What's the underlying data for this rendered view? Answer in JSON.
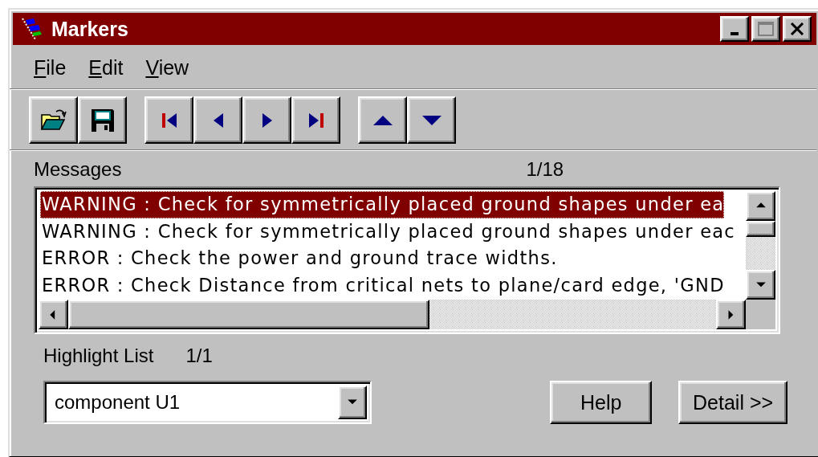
{
  "window": {
    "title": "Markers"
  },
  "menu": [
    {
      "label": "File"
    },
    {
      "label": "Edit"
    },
    {
      "label": "View"
    }
  ],
  "toolbar_groups": [
    [
      {
        "kind": "open"
      },
      {
        "kind": "save"
      }
    ],
    [
      {
        "kind": "first"
      },
      {
        "kind": "previous"
      },
      {
        "kind": "next"
      },
      {
        "kind": "last"
      }
    ],
    [
      {
        "kind": "up"
      },
      {
        "kind": "down"
      }
    ]
  ],
  "messages": {
    "label": "Messages",
    "counter": "1/18",
    "rows": [
      {
        "text": "WARNING : Check for symmetrically placed ground shapes under ea",
        "selected": true
      },
      {
        "text": "WARNING : Check for symmetrically placed ground shapes under eac",
        "selected": false
      },
      {
        "text": "ERROR : Check the power and ground trace widths.",
        "selected": false
      },
      {
        "text": "ERROR : Check Distance from critical nets to plane/card edge, 'GND",
        "selected": false
      }
    ]
  },
  "highlight": {
    "label": "Highlight List",
    "counter": "1/1",
    "combo": {
      "value": "component U1"
    }
  },
  "buttons": [
    {
      "label": "Help"
    },
    {
      "label": "Detail >>"
    }
  ]
}
